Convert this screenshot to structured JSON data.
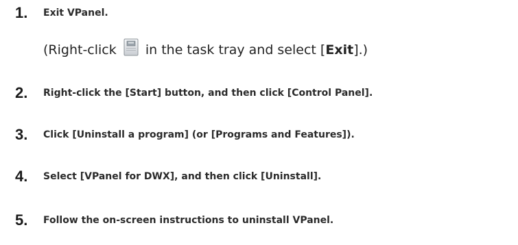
{
  "steps": [
    {
      "number": "1.",
      "text": "Exit VPanel."
    },
    {
      "number": "2.",
      "text": "Right-click the [Start] button, and then click [Control Panel]."
    },
    {
      "number": "3.",
      "text": "Click [Uninstall a program] (or [Programs and Features])."
    },
    {
      "number": "4.",
      "text": "Select [VPanel for DWX], and then click [Uninstall]."
    },
    {
      "number": "5.",
      "text": "Follow the on-screen instructions to uninstall VPanel."
    }
  ],
  "note": {
    "prefix": "(Right-click ",
    "icon": "vpanel-tray-icon",
    "middle": " in the task tray and select [",
    "bold": "Exit",
    "suffix": "].)"
  }
}
